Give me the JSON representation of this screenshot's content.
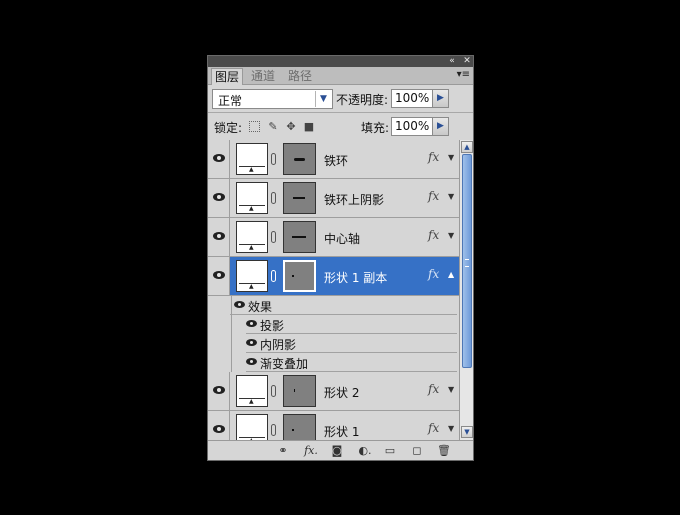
{
  "panel": {
    "titlebar": {
      "collapse_icon": "«",
      "close_icon": "✕"
    },
    "tabs": [
      {
        "label": "图层",
        "active": true
      },
      {
        "label": "通道",
        "active": false
      },
      {
        "label": "路径",
        "active": false
      }
    ],
    "menu_icon": "▾≡",
    "blend_mode": "正常",
    "opacity_label": "不透明度:",
    "opacity_value": "100%",
    "lock_label": "锁定:",
    "fill_label": "填充:",
    "fill_value": "100%",
    "layers": [
      {
        "name": "铁环",
        "selected": false,
        "fx": "fx"
      },
      {
        "name": "铁环上阴影",
        "selected": false,
        "fx": "fx"
      },
      {
        "name": "中心轴",
        "selected": false,
        "fx": "fx"
      },
      {
        "name": "形状 1 副本",
        "selected": true,
        "fx": "fx"
      },
      {
        "name": "形状 2",
        "selected": false,
        "fx": "fx"
      },
      {
        "name": "形状 1",
        "selected": false,
        "fx": "fx"
      }
    ],
    "effects": {
      "title": "效果",
      "items": [
        "投影",
        "内阴影",
        "渐变叠加"
      ]
    },
    "footer_icons": [
      "link-icon",
      "fx-icon",
      "mask-icon",
      "adjustment-icon",
      "group-icon",
      "new-layer-icon",
      "trash-icon"
    ]
  },
  "colors": {
    "selection": "#3671c6",
    "panel_bg": "#d6d6d6",
    "background": "#000000"
  }
}
